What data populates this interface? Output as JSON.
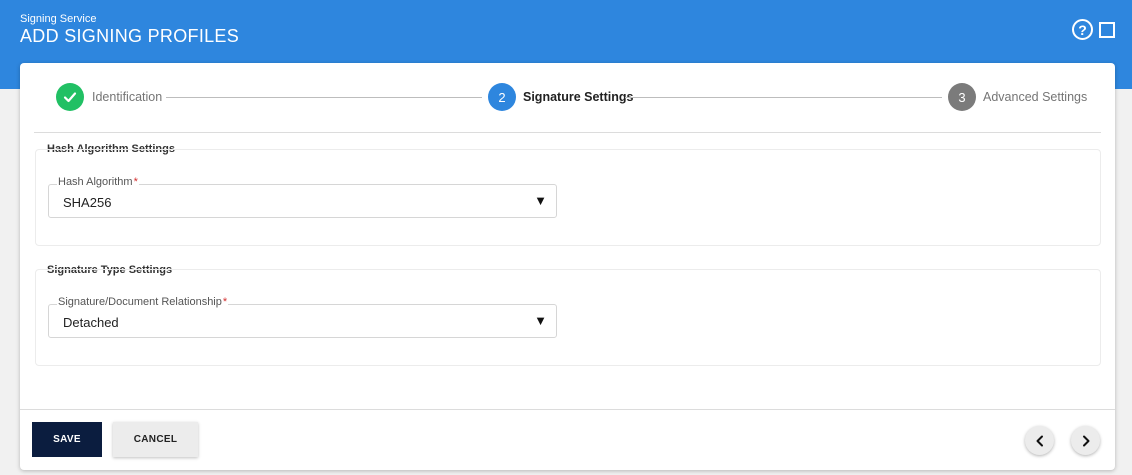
{
  "header": {
    "subtitle": "Signing Service",
    "title": "ADD SIGNING PROFILES",
    "help_icon": "question-circle-icon",
    "maximize_icon": "square-icon",
    "background_color": "#2e86de"
  },
  "stepper": {
    "steps": [
      {
        "number": "",
        "label": "Identification",
        "state": "completed",
        "icon": "checkmark-icon",
        "color": "#21c064"
      },
      {
        "number": "2",
        "label": "Signature Settings",
        "state": "active",
        "color": "#2e86de"
      },
      {
        "number": "3",
        "label": "Advanced Settings",
        "state": "inactive",
        "color": "#7b7b7b"
      }
    ]
  },
  "sections": {
    "hash": {
      "title": "Hash Algorithm Settings",
      "field_label": "Hash Algorithm",
      "required_mark": "*",
      "value": "SHA256"
    },
    "signature_type": {
      "title": "Signature Type Settings",
      "field_label": "Signature/Document Relationship",
      "required_mark": "*",
      "value": "Detached"
    }
  },
  "footer": {
    "save_label": "SAVE",
    "cancel_label": "CANCEL",
    "save_color": "#0b1d3f",
    "prev_icon": "chevron-left-icon",
    "next_icon": "chevron-right-icon"
  }
}
